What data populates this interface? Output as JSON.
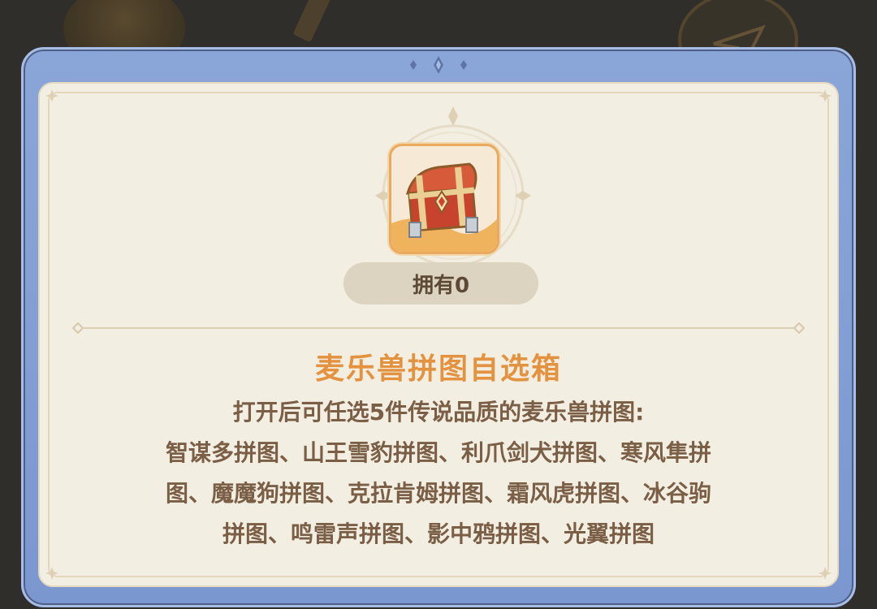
{
  "item": {
    "icon": "treasure-chest-icon",
    "owned_label": "拥有0",
    "name": "麦乐兽拼图自选箱",
    "description_lines": [
      "打开后可任选5件传说品质的麦乐兽拼图:",
      "智谋多拼图、山王雪豹拼图、利爪剑犬拼图、寒风隼拼",
      "图、魔魔狗拼图、克拉肯姆拼图、霜风虎拼图、冰谷驹",
      "拼图、鸣雷声拼图、影中鸦拼图、光翼拼图"
    ]
  },
  "colors": {
    "frame_blue": "#8aa6d8",
    "panel_cream": "#f3eee2",
    "title_orange": "#e3923f",
    "text_brown": "#7a5e45"
  }
}
